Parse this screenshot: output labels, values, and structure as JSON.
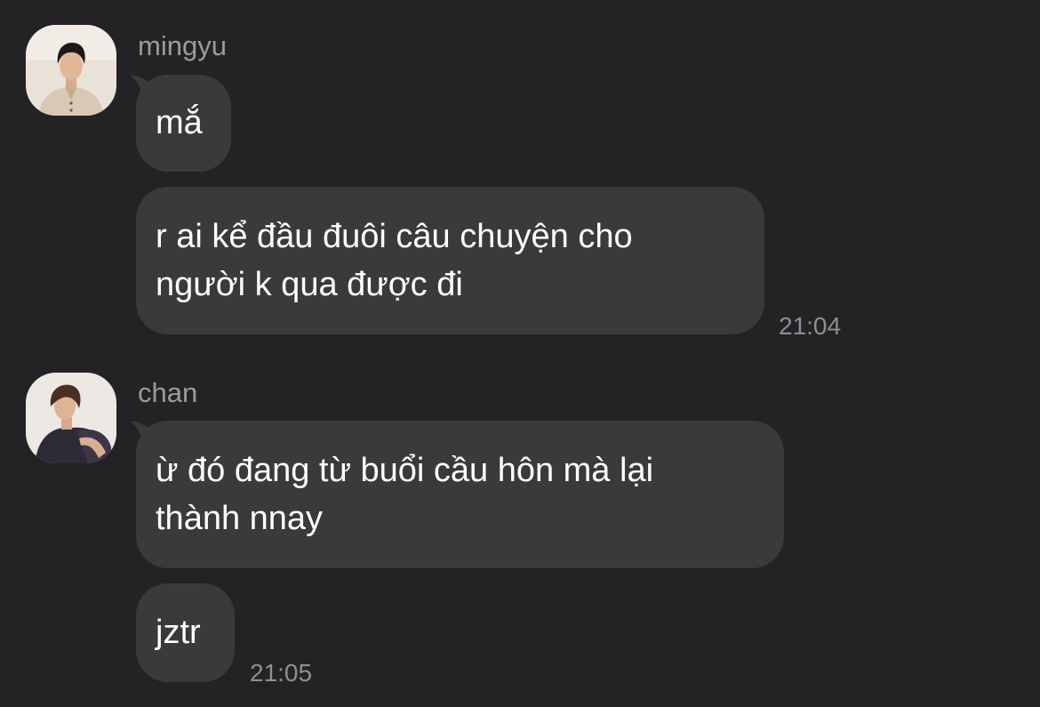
{
  "chat": {
    "groups": [
      {
        "sender": "mingyu",
        "avatar_icon": "user-photo-avatar",
        "messages": [
          {
            "text": "mắ"
          },
          {
            "text": "r ai kể đầu đuôi câu chuyện cho\nngười k qua được đi",
            "time": "21:04"
          }
        ]
      },
      {
        "sender": "chan",
        "avatar_icon": "user-photo-avatar",
        "messages": [
          {
            "text": "ừ đó đang từ buổi cầu hôn mà lại\nthành nnay"
          },
          {
            "text": "jztr",
            "time": "21:05"
          }
        ]
      }
    ]
  },
  "colors": {
    "background": "#232325",
    "bubble": "#3a3a3c",
    "sender_name": "#9b9b9f",
    "timestamp": "#8e8e93",
    "text": "#ffffff"
  }
}
